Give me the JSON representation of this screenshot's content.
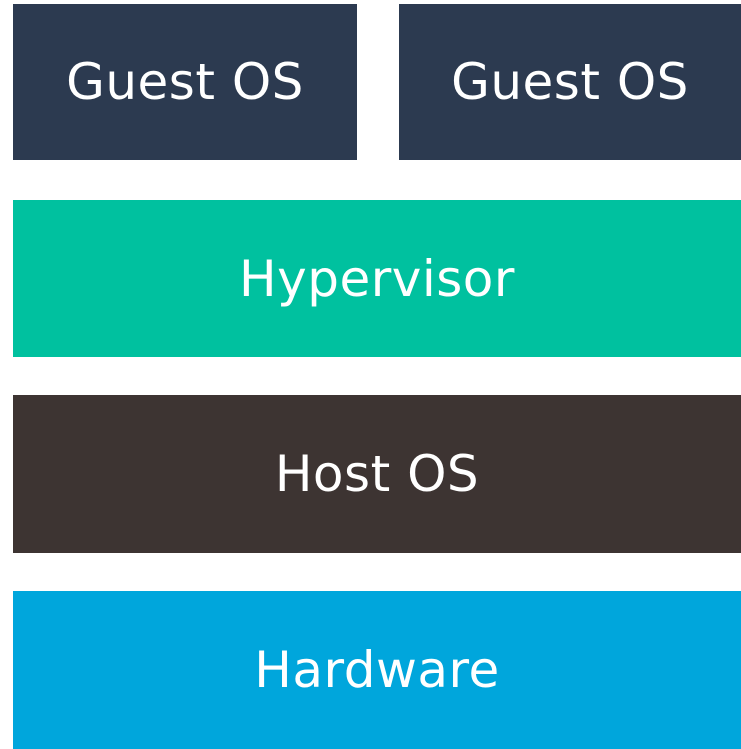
{
  "layers": {
    "guest_os_left": {
      "label": "Guest OS",
      "color": "#2c3a50"
    },
    "guest_os_right": {
      "label": "Guest OS",
      "color": "#2c3a50"
    },
    "hypervisor": {
      "label": "Hypervisor",
      "color": "#00c19f"
    },
    "host_os": {
      "label": "Host OS",
      "color": "#3d3432"
    },
    "hardware": {
      "label": "Hardware",
      "color": "#00a6dc"
    }
  }
}
